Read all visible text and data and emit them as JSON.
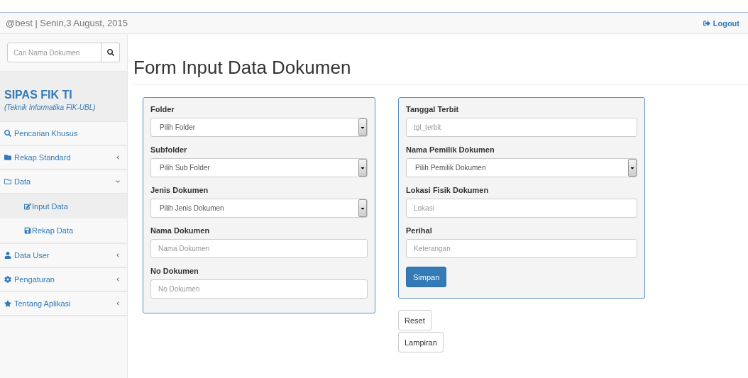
{
  "header": {
    "user_date": "@best | Senin,3 August, 2015",
    "logout": "Logout"
  },
  "sidebar": {
    "search": {
      "placeholder": "Cari Nama Dokumen"
    },
    "brand": {
      "title": "SIPAS FIK TI",
      "subtitle": "(Teknik Informatika FIK-UBL)"
    },
    "items": [
      {
        "label": "Pencarian Khusus",
        "kind": "link"
      },
      {
        "label": "Rekap Standard",
        "kind": "menu",
        "expanded": false
      },
      {
        "label": "Data",
        "kind": "menu",
        "expanded": true,
        "children": [
          {
            "label": "Input Data",
            "selected": true
          },
          {
            "label": "Rekap Data",
            "selected": false
          }
        ]
      },
      {
        "label": "Data User",
        "kind": "menu",
        "expanded": false
      },
      {
        "label": "Pengaturan",
        "kind": "menu",
        "expanded": false
      },
      {
        "label": "Tentang Aplikasi",
        "kind": "menu",
        "expanded": false
      }
    ]
  },
  "page_title": "Form Input Data Dokumen",
  "panels": [
    {
      "fields": [
        {
          "label": "Folder",
          "kind": "select",
          "value": "Pilih Folder"
        },
        {
          "label": "Subfolder",
          "kind": "select",
          "value": "Pilih Sub Folder"
        },
        {
          "label": "Jenis Dokumen",
          "kind": "select",
          "value": "Pilih Jenis Dokumen"
        },
        {
          "label": "Nama Dokumen",
          "kind": "input",
          "placeholder": "Nama Dokumen"
        },
        {
          "label": "No Dokumen",
          "kind": "input",
          "placeholder": "No Dokumen"
        }
      ]
    },
    {
      "fields": [
        {
          "label": "Tanggal Terbit",
          "kind": "input",
          "placeholder": "tgl_terbit"
        },
        {
          "label": "Nama Pemilik Dokumen",
          "kind": "select",
          "value": "Pilih Pemilik Dokumen"
        },
        {
          "label": "Lokasi Fisik Dokumen",
          "kind": "input",
          "placeholder": "Lokasi"
        },
        {
          "label": "Perihal",
          "kind": "input",
          "placeholder": "Keterangan"
        }
      ],
      "submit": "Simpan"
    }
  ],
  "extra_buttons": [
    "Reset",
    "Lampiran"
  ]
}
